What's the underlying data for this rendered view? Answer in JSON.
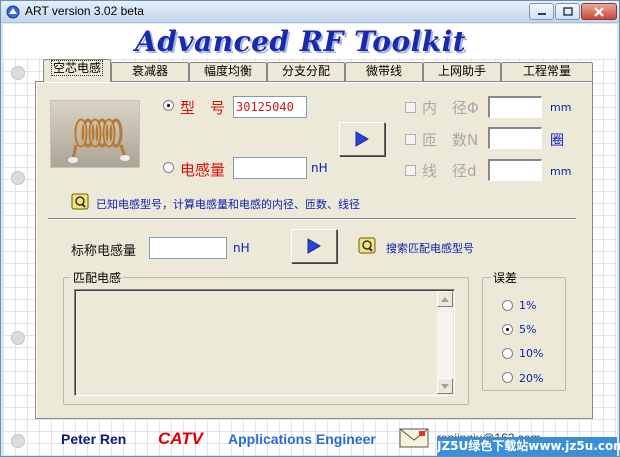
{
  "window": {
    "title": "ART version 3.02 beta"
  },
  "app_title": "Advanced RF Toolkit",
  "tabs": [
    {
      "label": "空芯电感",
      "active": true
    },
    {
      "label": "衰减器",
      "active": false
    },
    {
      "label": "幅度均衡",
      "active": false
    },
    {
      "label": "分支分配",
      "active": false
    },
    {
      "label": "微带线",
      "active": false
    },
    {
      "label": "上网助手",
      "active": false
    },
    {
      "label": "工程常量",
      "active": false
    }
  ],
  "input": {
    "model_label": "型　号",
    "model_value": "30125040",
    "model_selected": true,
    "inductance_label": "电感量",
    "inductance_value": "",
    "inductance_unit": "nH",
    "inductance_selected": false
  },
  "outputs": {
    "inner_dia_label": "内　径Φ",
    "inner_dia_value": "",
    "inner_dia_unit": "mm",
    "turns_label": "匝　数N",
    "turns_value": "",
    "turns_unit": "圈",
    "wire_dia_label": "线　径d",
    "wire_dia_value": "",
    "wire_dia_unit": "mm"
  },
  "hint_text": "已知电感型号，计算电感量和电感的内径、匝数、线径",
  "search": {
    "nominal_label": "标称电感量",
    "nominal_value": "",
    "nominal_unit": "nH",
    "search_label": "搜索匹配电感型号"
  },
  "match_group": {
    "label": "匹配电感"
  },
  "error_group": {
    "label": "误差",
    "options": [
      {
        "label": "1%",
        "selected": false
      },
      {
        "label": "5%",
        "selected": true
      },
      {
        "label": "10%",
        "selected": false
      },
      {
        "label": "20%",
        "selected": false
      }
    ]
  },
  "footer": {
    "author": "Peter Ren",
    "company": "CATV",
    "role": "Applications Engineer",
    "email": "renjinqiu@163.com",
    "watermark": "JZ5U绿色下载站www.jz5u.com"
  },
  "colors": {
    "title_blue": "#1a2aa8",
    "label_red": "#d81010",
    "catv_red": "#e00000",
    "role_blue": "#2a6ad4"
  }
}
